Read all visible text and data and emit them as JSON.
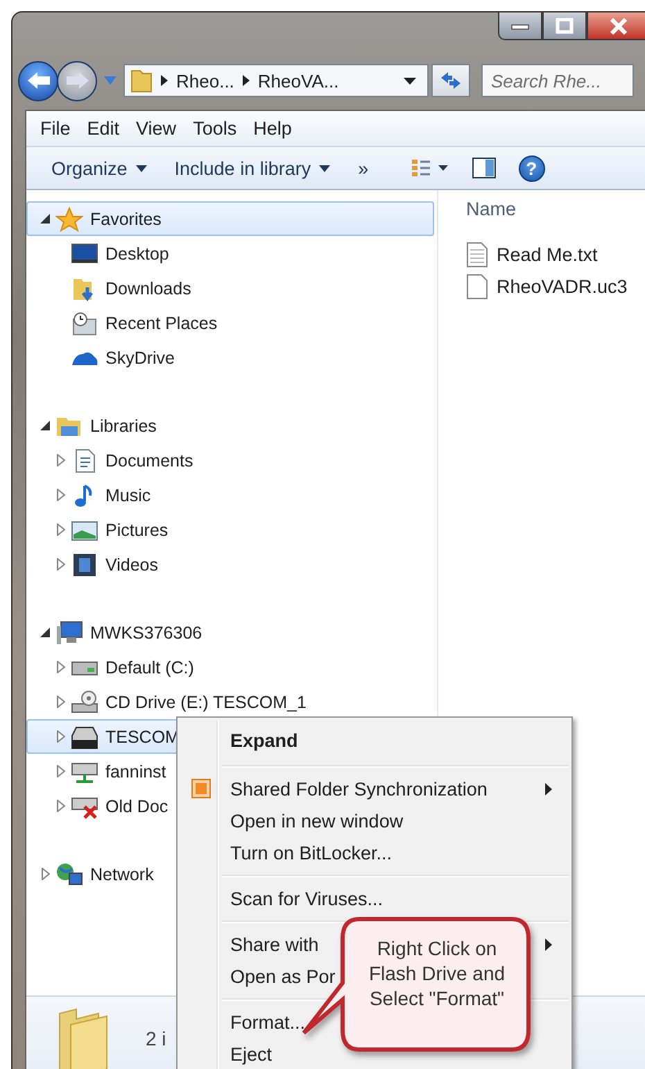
{
  "address": {
    "crumbs": [
      "Rheo...",
      "RheoVA..."
    ]
  },
  "search": {
    "placeholder": "Search Rhe..."
  },
  "menu_bar": [
    "File",
    "Edit",
    "View",
    "Tools",
    "Help"
  ],
  "toolbar": [
    {
      "label": "Organize",
      "dropdown": true
    },
    {
      "label": "Include in library",
      "dropdown": true
    },
    {
      "label": "»",
      "dropdown": false
    }
  ],
  "help_button": "?",
  "nav_tree": [
    {
      "label": "Favorites",
      "kind": "star",
      "expanded": true,
      "selected": true,
      "children": [
        {
          "label": "Desktop",
          "kind": "desktop",
          "selected": false
        },
        {
          "label": "Downloads",
          "kind": "downloads",
          "selected": false
        },
        {
          "label": "Recent Places",
          "kind": "recent",
          "selected": false
        },
        {
          "label": "SkyDrive",
          "kind": "cloud",
          "selected": false
        }
      ]
    },
    {
      "label": "Libraries",
      "kind": "library",
      "expanded": true,
      "selected": false,
      "children": [
        {
          "label": "Documents",
          "kind": "document",
          "expanded": false,
          "selected": false
        },
        {
          "label": "Music",
          "kind": "music",
          "expanded": false,
          "selected": false
        },
        {
          "label": "Pictures",
          "kind": "pictures",
          "expanded": false,
          "selected": false
        },
        {
          "label": "Videos",
          "kind": "video",
          "expanded": false,
          "selected": false
        }
      ]
    },
    {
      "label": "MWKS376306",
      "kind": "computer",
      "expanded": true,
      "selected": false,
      "children": [
        {
          "label": "Default (C:)",
          "kind": "drive",
          "expanded": false,
          "selected": false
        },
        {
          "label": "CD Drive (E:) TESCOM_1",
          "kind": "cd",
          "expanded": false,
          "selected": false
        },
        {
          "label": "TESCOM",
          "kind": "usb",
          "expanded": false,
          "selected": true
        },
        {
          "label": "fanninst",
          "kind": "netdrive",
          "expanded": false,
          "selected": false
        },
        {
          "label": "Old Doc",
          "kind": "lostdrive",
          "expanded": false,
          "selected": false
        }
      ]
    },
    {
      "label": "Network",
      "kind": "network",
      "expanded": false,
      "selected": false
    }
  ],
  "files": {
    "column": "Name",
    "items": [
      {
        "name": "Read Me.txt",
        "kind": "text"
      },
      {
        "name": "RheoVADR.uc3",
        "kind": "blank"
      }
    ]
  },
  "status_bar": {
    "text": "2 i"
  },
  "context_menu": [
    {
      "label": "Expand",
      "kind": "item",
      "bold": true,
      "submenu": false
    },
    {
      "kind": "separator"
    },
    {
      "label": "Shared Folder Synchronization",
      "kind": "item",
      "bold": false,
      "submenu": true,
      "icon": true
    },
    {
      "label": "Open in new window",
      "kind": "item",
      "bold": false,
      "submenu": false
    },
    {
      "label": "Turn on BitLocker...",
      "kind": "item",
      "bold": false,
      "submenu": false
    },
    {
      "kind": "separator"
    },
    {
      "label": "Scan for Viruses...",
      "kind": "item",
      "bold": false,
      "submenu": false
    },
    {
      "kind": "separator"
    },
    {
      "label": "Share with",
      "kind": "item",
      "bold": false,
      "submenu": true
    },
    {
      "label": "Open as Por",
      "kind": "item",
      "bold": false,
      "submenu": false
    },
    {
      "kind": "separator"
    },
    {
      "label": "Format...",
      "kind": "item",
      "bold": false,
      "submenu": false
    },
    {
      "label": "Eject",
      "kind": "item",
      "bold": false,
      "submenu": false
    }
  ],
  "callout": {
    "text": "Right Click on Flash Drive and Select \"Format\""
  }
}
